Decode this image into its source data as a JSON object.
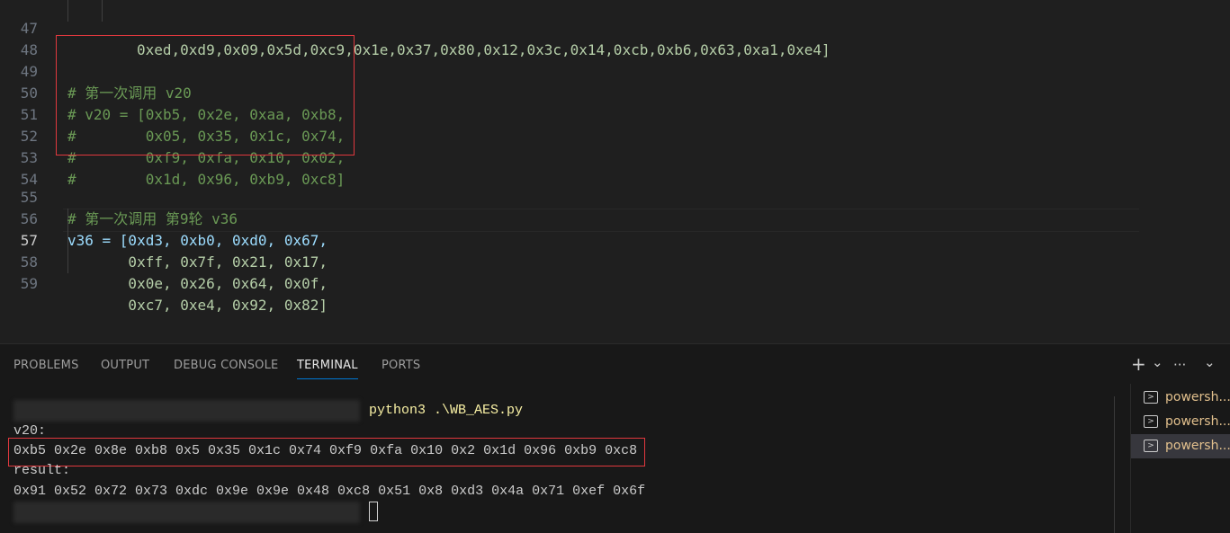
{
  "editor": {
    "lines": [
      {
        "num": "47",
        "text": "0xed,0xd9,0x09,0x5d,0xc9,0x1e,0x37,0x80,0x12,0x3c,0x14,0xcb,0xb6,0x63,0xa1,0xe4]"
      },
      {
        "num": "48",
        "text": ""
      },
      {
        "num": "49",
        "text": "# 第一次调用 v20"
      },
      {
        "num": "50",
        "text": "# v20 = [0xb5, 0x2e, 0xaa, 0xb8,"
      },
      {
        "num": "51",
        "text": "#        0x05, 0x35, 0x1c, 0x74,"
      },
      {
        "num": "52",
        "text": "#        0xf9, 0xfa, 0x10, 0x02,"
      },
      {
        "num": "53",
        "text": "#        0x1d, 0x96, 0xb9, 0xc8]"
      },
      {
        "num": "54",
        "text": ""
      },
      {
        "num": "55",
        "text": "# 第一次调用 第9轮 v36"
      },
      {
        "num": "56",
        "text": "v36 = [0xd3, 0xb0, 0xd0, 0x67,"
      },
      {
        "num": "57",
        "text": "       0xff, 0x7f, 0x21, 0x17,"
      },
      {
        "num": "58",
        "text": "       0x0e, 0x26, 0x64, 0x0f,"
      },
      {
        "num": "59",
        "text": "       0xc7, 0xe4, 0x92, 0x82]"
      }
    ]
  },
  "panel": {
    "tabs": [
      "PROBLEMS",
      "OUTPUT",
      "DEBUG CONSOLE",
      "TERMINAL",
      "PORTS"
    ],
    "active_tab": "TERMINAL",
    "toolbar": {
      "add": "+",
      "dropdown": "⌄",
      "more": "···",
      "collapse": "⌄"
    }
  },
  "terminal": {
    "command": "python3 .\\WB_AES.py",
    "lines": [
      "v20:",
      "0xb5 0x2e 0x8e 0xb8 0x5 0x35 0x1c 0x74 0xf9 0xfa 0x10 0x2 0x1d 0x96 0xb9 0xc8",
      "result:",
      "0x91 0x52 0x72 0x73 0xdc 0x9e 0x9e 0x48 0xc8 0x51 0x8 0xd3 0x4a 0x71 0xef 0x6f"
    ],
    "instances": [
      "powersh...",
      "powersh...",
      "powersh..."
    ],
    "selected_instance": 2
  },
  "colors": {
    "highlight_box": "#e0383e",
    "accent": "#0078d4",
    "comment": "#6a9955",
    "number": "#b5cea8"
  }
}
